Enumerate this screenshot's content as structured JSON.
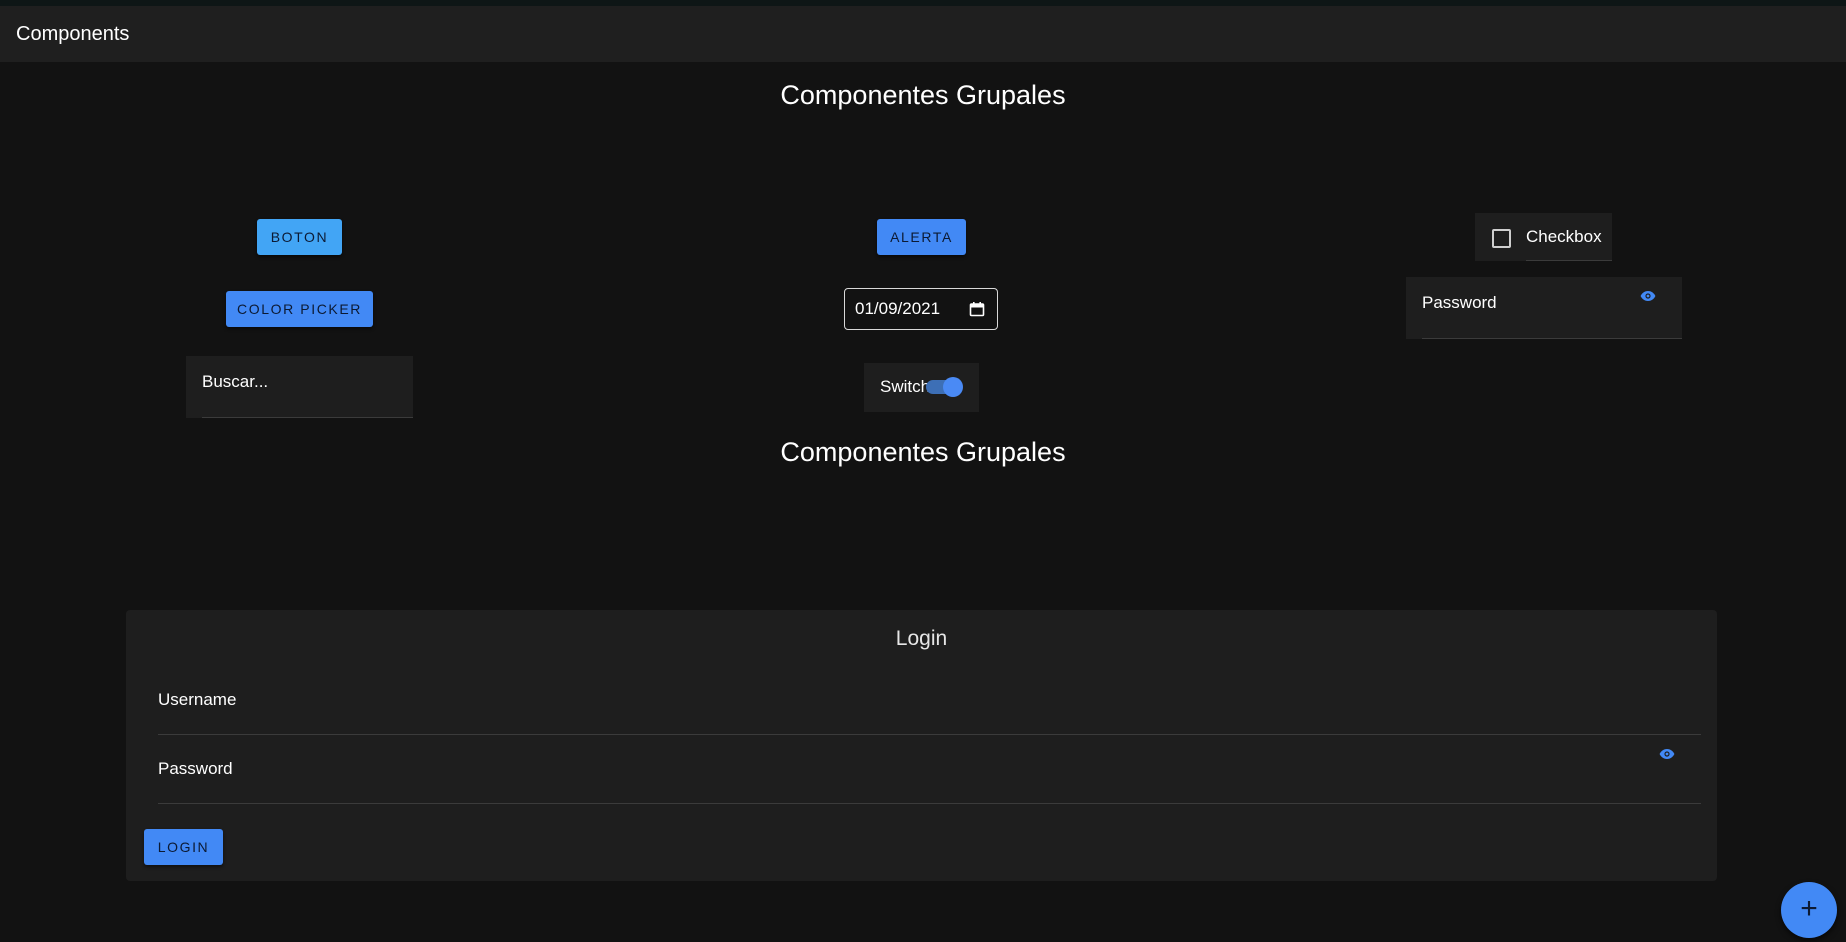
{
  "toolbar": {
    "title": "Components"
  },
  "sections": {
    "heading_1": "Componentes Grupales",
    "heading_2": "Componentes Grupales"
  },
  "controls": {
    "boton_label": "Boton",
    "alerta_label": "Alerta",
    "color_picker_label": "Color Picker",
    "search_label": "Buscar...",
    "date_value": "01/09/2021",
    "switch_label": "Switch",
    "switch_on": true,
    "checkbox_label": "Checkbox",
    "checkbox_checked": false,
    "password_label": "Password"
  },
  "login": {
    "title": "Login",
    "username_label": "Username",
    "password_label": "Password",
    "button_label": "Login"
  },
  "fab": {
    "icon": "plus-icon",
    "glyph": "+"
  },
  "colors": {
    "background": "#121212",
    "toolbar": "#1f1f1f",
    "primary": "#4289f5",
    "button_light": "#42a5f5",
    "surface": "#1e1e1e"
  }
}
